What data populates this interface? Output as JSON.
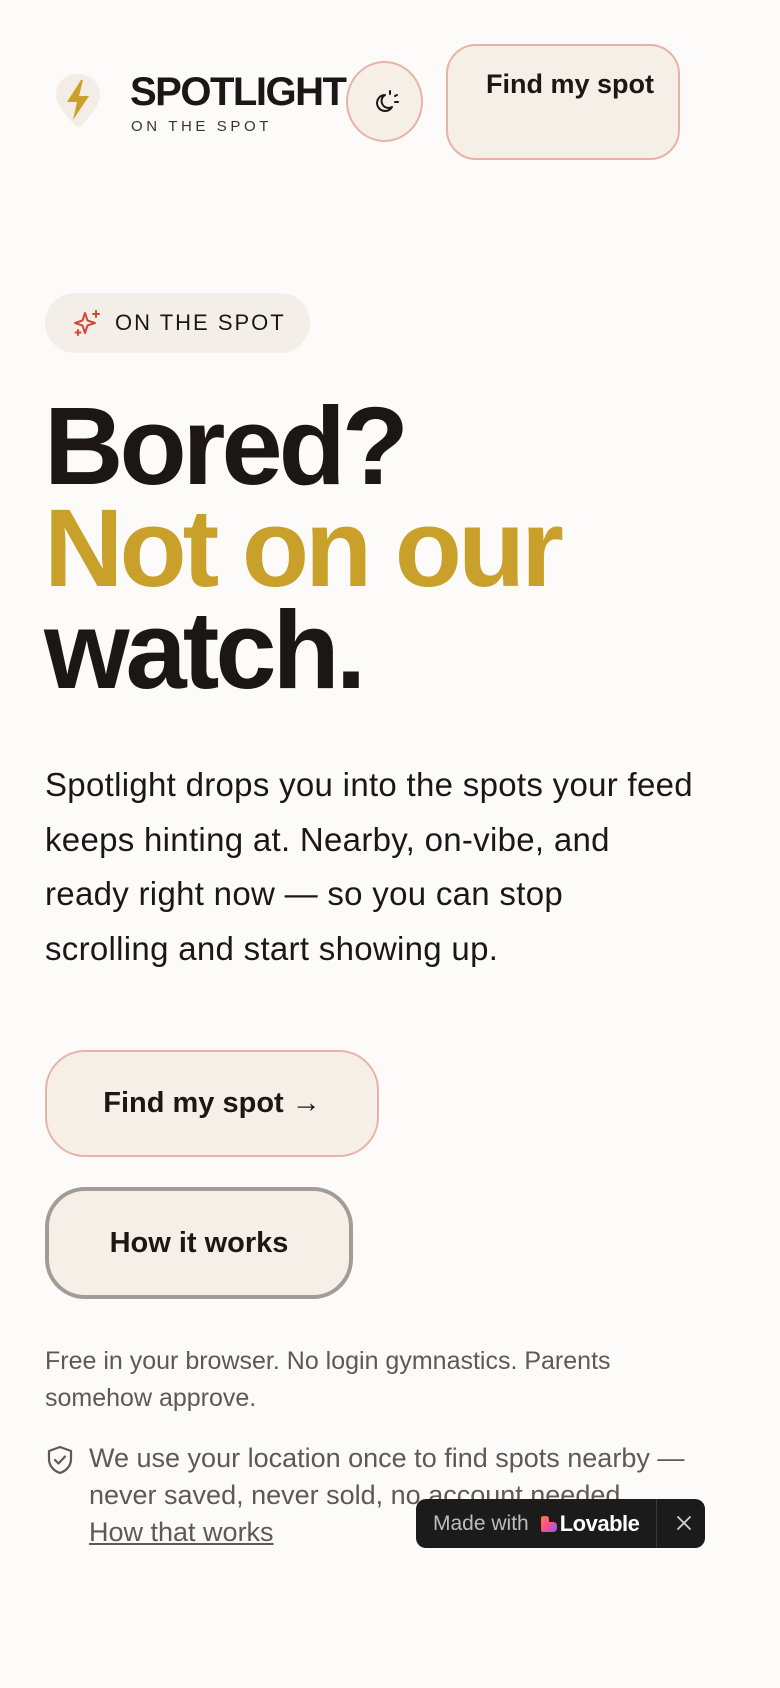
{
  "brand": {
    "name": "SPOTLIGHT",
    "tagline": "ON THE SPOT",
    "logo_icon": "lightning-pin-icon"
  },
  "header": {
    "theme_toggle_icon": "moon-sun-icon",
    "cta_label": "Find my spot"
  },
  "hero": {
    "badge_icon": "sparkles-icon",
    "badge_label": "ON THE SPOT",
    "headline_line1": "Bored?",
    "headline_line2": "Not on our",
    "headline_line3": "watch.",
    "lede": "Spotlight drops you into the spots your feed keeps hinting at. Nearby, on-vibe, and ready right now — so you can stop scrolling and start showing up.",
    "primary_button": "Find my spot →",
    "secondary_button": "How it works",
    "fine_print": "Free in your browser. No login gymnastics. Parents somehow approve.",
    "privacy_icon": "shield-check-icon",
    "privacy_text": "We use your location once to find spots nearby — never saved, never sold, no account needed.",
    "privacy_link": "How that works"
  },
  "lovable_badge": {
    "made_with": "Made with",
    "name": "Lovable",
    "close_icon": "close-icon"
  },
  "colors": {
    "background": "#fcfbf9",
    "accent_gold": "#c9a12a",
    "button_border_pink": "#e8b3a6",
    "button_fill": "#f5efe8",
    "text_dark": "#1c1714",
    "text_muted": "#5f5853"
  }
}
